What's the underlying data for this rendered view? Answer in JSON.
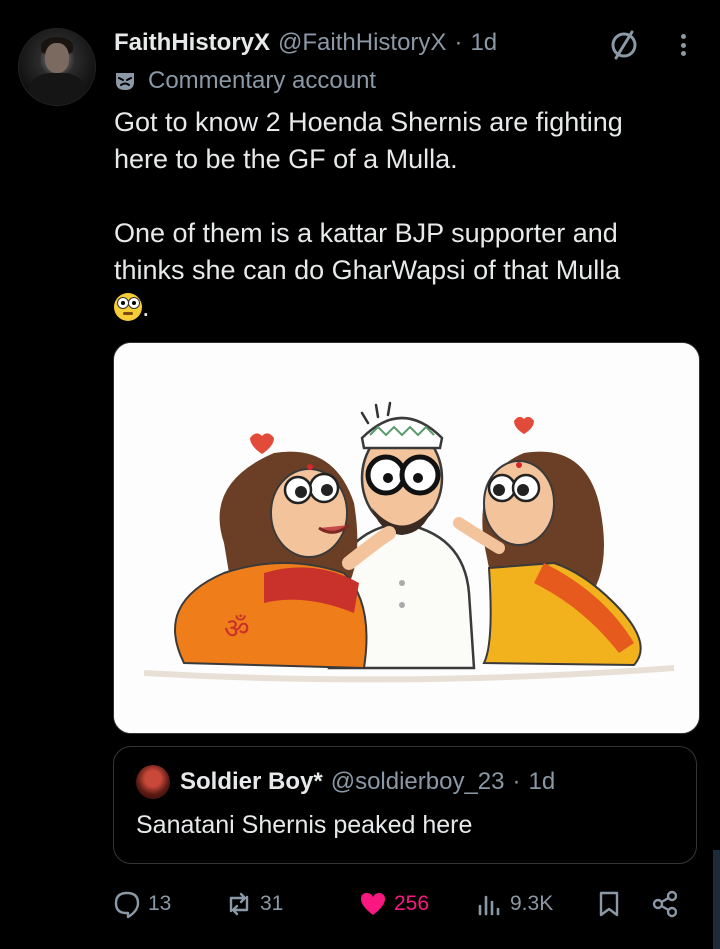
{
  "tweet": {
    "author_name": "FaithHistoryX",
    "author_handle": "@FaithHistoryX",
    "separator": "·",
    "time": "1d",
    "label": "Commentary account",
    "lines": [
      "Got to know 2 Hoenda Shernis are fighting",
      "here to be the GF of a Mulla.",
      "",
      "One of them is a kattar BJP supporter and",
      "thinks she can do GharWapsi of that Mulla"
    ],
    "last_line_suffix": ".",
    "image_caption": "ॐ"
  },
  "quote": {
    "author_name": "Soldier Boy*",
    "author_handle": "@soldierboy_23",
    "separator": "·",
    "time": "1d",
    "text": "Sanatani Shernis peaked here"
  },
  "actions": {
    "replies": "13",
    "reposts": "31",
    "likes": "256",
    "views": "9.3K"
  },
  "icons": {
    "mute": "mute-icon",
    "more": "more-icon",
    "commentary": "mask-icon",
    "reply": "reply-icon",
    "repost": "repost-icon",
    "like": "heart-icon",
    "views": "views-icon",
    "bookmark": "bookmark-icon",
    "share": "share-icon"
  },
  "colors": {
    "background": "#000000",
    "text": "#e7e9ea",
    "secondary": "#8b98a5",
    "like": "#f91880"
  }
}
